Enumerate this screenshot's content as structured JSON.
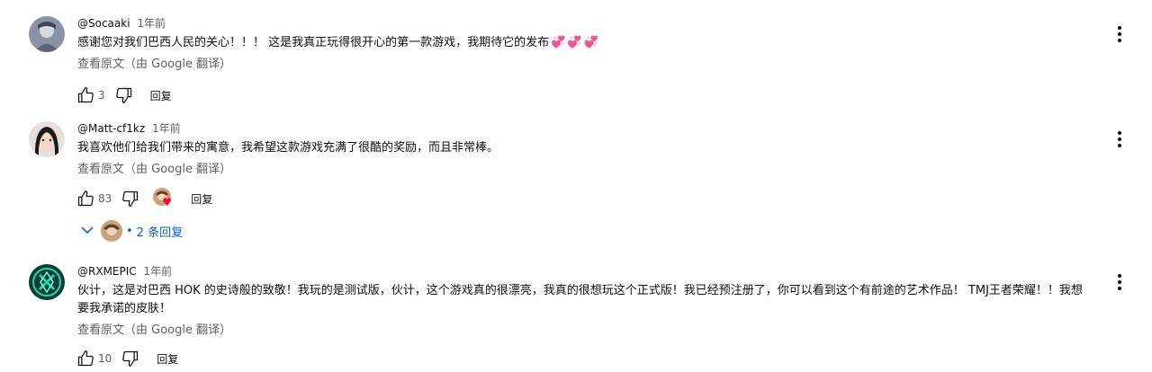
{
  "comments": [
    {
      "author": "@Socaaki",
      "time": "1年前",
      "text": "感谢您对我们巴西人民的关心！！！ 这是我真正玩得很开心的第一款游戏，我期待它的发布",
      "emoji": "💞💞💞",
      "translate_label": "查看原文（由 Google 翻译）",
      "likes": "3",
      "reply_label": "回复"
    },
    {
      "author": "@Matt-cf1kz",
      "time": "1年前",
      "text": "我喜欢他们给我们带来的寓意，我希望这款游戏充满了很酷的奖励，而且非常棒。",
      "translate_label": "查看原文（由 Google 翻译）",
      "likes": "83",
      "reply_label": "回复",
      "replies_label": "2 条回复"
    },
    {
      "author": "@RXMEPIC",
      "time": "1年前",
      "text": "伙计，这是对巴西 HOK 的史诗般的致敬！我玩的是测试版，伙计，这个游戏真的很漂亮，我真的很想玩这个正式版！我已经预注册了，你可以看到这个有前途的艺术作品！ TMJ王者荣耀！！我想要我承诺的皮肤！",
      "translate_label": "查看原文（由 Google 翻译）",
      "likes": "10",
      "reply_label": "回复"
    }
  ],
  "icons": {
    "like": "thumbs-up-icon",
    "dislike": "thumbs-down-icon",
    "menu": "more-vert-icon",
    "chevron": "chevron-down-icon",
    "heart": "creator-heart-icon"
  },
  "colors": {
    "link_blue": "#065fd4",
    "secondary_text": "#606060",
    "heart_red": "#ff0033",
    "emoji_pink": "#e47abf"
  }
}
